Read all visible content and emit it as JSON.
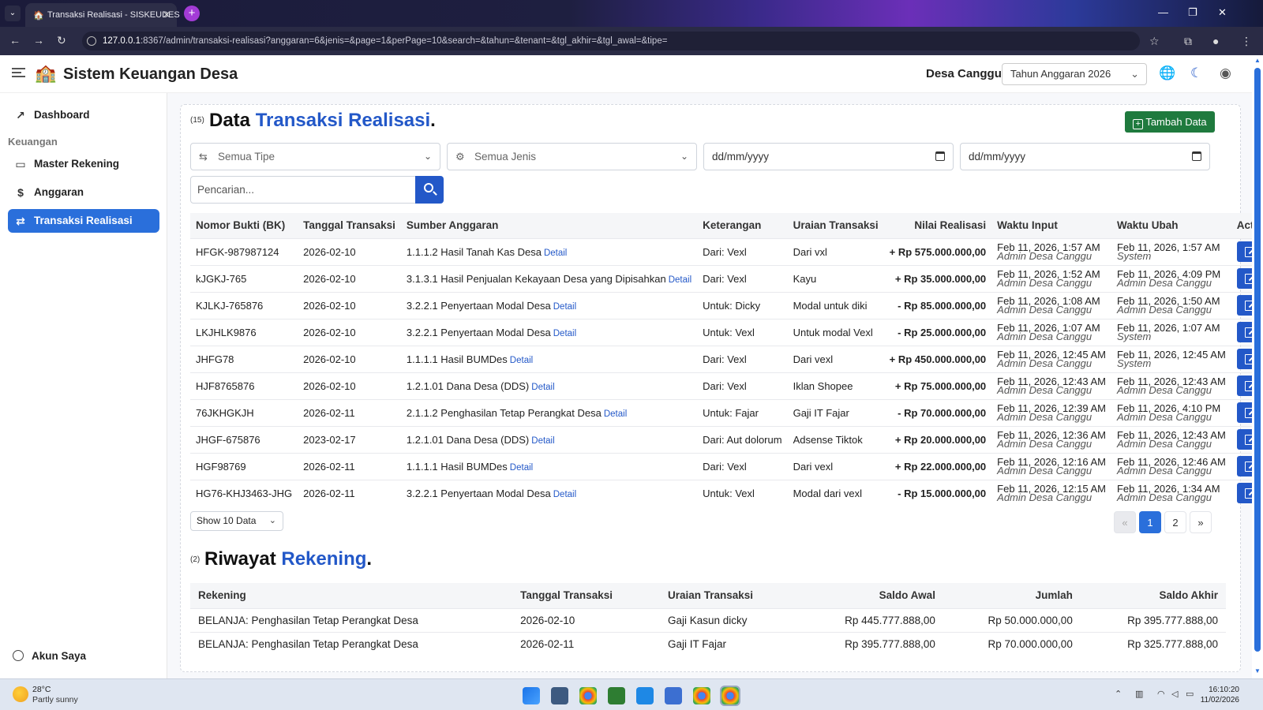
{
  "browser": {
    "tab_title": "Transaksi Realisasi - SISKEUDES",
    "url_host": "127.0.0.1",
    "url_rest": ":8367/admin/transaksi-realisasi?anggaran=6&jenis=&page=1&perPage=10&search=&tahun=&tenant=&tgl_akhir=&tgl_awal=&tipe="
  },
  "header": {
    "app_title": "Sistem Keuangan Desa",
    "desa": "Desa Canggu",
    "year_select": "Tahun Anggaran 2026"
  },
  "sidebar": {
    "dashboard": "Dashboard",
    "section": "Keuangan",
    "items": [
      {
        "label": "Master Rekening",
        "icon": "folder-icon"
      },
      {
        "label": "Anggaran",
        "icon": "dollar-icon"
      },
      {
        "label": "Transaksi Realisasi",
        "icon": "exchange-icon"
      }
    ],
    "account": "Akun Saya"
  },
  "transactions": {
    "count": "(15)",
    "title_plain": "Data ",
    "title_accent": "Transaksi Realisasi",
    "title_dot": ".",
    "add_button": "Tambah Data",
    "filters": {
      "tipe": "Semua Tipe",
      "jenis": "Semua Jenis",
      "tgl_awal": "dd/mm/yyyy",
      "tgl_akhir": "dd/mm/yyyy"
    },
    "search_placeholder": "Pencarian...",
    "columns": [
      "Nomor Bukti (BK)",
      "Tanggal Transaksi",
      "Sumber Anggaran",
      "Keterangan",
      "Uraian Transaksi",
      "Nilai Realisasi",
      "Waktu Input",
      "Waktu Ubah",
      "Action"
    ],
    "detail_label": "Detail",
    "rows": [
      {
        "bk": "HFGK-987987124",
        "date": "2026-02-10",
        "source": "1.1.1.2 Hasil Tanah Kas Desa",
        "ket": "Dari: Vexl",
        "uraian": "Dari vxl",
        "flow": "in",
        "nilai": "+ Rp 575.000.000,00",
        "input_time": "Feb 11, 2026, 1:57 AM",
        "input_by": "Admin Desa Canggu",
        "update_time": "Feb 11, 2026, 1:57 AM",
        "update_by": "System"
      },
      {
        "bk": "kJGKJ-765",
        "date": "2026-02-10",
        "source": "3.1.3.1 Hasil Penjualan Kekayaan Desa yang Dipisahkan",
        "ket": "Dari: Vexl",
        "uraian": "Kayu",
        "flow": "in",
        "nilai": "+ Rp 35.000.000,00",
        "input_time": "Feb 11, 2026, 1:52 AM",
        "input_by": "Admin Desa Canggu",
        "update_time": "Feb 11, 2026, 4:09 PM",
        "update_by": "Admin Desa Canggu"
      },
      {
        "bk": "KJLKJ-765876",
        "date": "2026-02-10",
        "source": "3.2.2.1 Penyertaan Modal Desa",
        "ket": "Untuk: Dicky",
        "uraian": "Modal untuk diki",
        "flow": "out",
        "nilai": "- Rp 85.000.000,00",
        "input_time": "Feb 11, 2026, 1:08 AM",
        "input_by": "Admin Desa Canggu",
        "update_time": "Feb 11, 2026, 1:50 AM",
        "update_by": "Admin Desa Canggu"
      },
      {
        "bk": "LKJHLK9876",
        "date": "2026-02-10",
        "source": "3.2.2.1 Penyertaan Modal Desa",
        "ket": "Untuk: Vexl",
        "uraian": "Untuk modal Vexl",
        "flow": "out",
        "nilai": "- Rp 25.000.000,00",
        "input_time": "Feb 11, 2026, 1:07 AM",
        "input_by": "Admin Desa Canggu",
        "update_time": "Feb 11, 2026, 1:07 AM",
        "update_by": "System"
      },
      {
        "bk": "JHFG78",
        "date": "2026-02-10",
        "source": "1.1.1.1 Hasil BUMDes",
        "ket": "Dari: Vexl",
        "uraian": "Dari vexl",
        "flow": "in",
        "nilai": "+ Rp 450.000.000,00",
        "input_time": "Feb 11, 2026, 12:45 AM",
        "input_by": "Admin Desa Canggu",
        "update_time": "Feb 11, 2026, 12:45 AM",
        "update_by": "System"
      },
      {
        "bk": "HJF8765876",
        "date": "2026-02-10",
        "source": "1.2.1.01 Dana Desa (DDS)",
        "ket": "Dari: Vexl",
        "uraian": "Iklan Shopee",
        "flow": "in",
        "nilai": "+ Rp 75.000.000,00",
        "input_time": "Feb 11, 2026, 12:43 AM",
        "input_by": "Admin Desa Canggu",
        "update_time": "Feb 11, 2026, 12:43 AM",
        "update_by": "Admin Desa Canggu"
      },
      {
        "bk": "76JKHGKJH",
        "date": "2026-02-11",
        "source": "2.1.1.2 Penghasilan Tetap Perangkat Desa",
        "ket": "Untuk: Fajar",
        "uraian": "Gaji IT Fajar",
        "flow": "out",
        "nilai": "- Rp 70.000.000,00",
        "input_time": "Feb 11, 2026, 12:39 AM",
        "input_by": "Admin Desa Canggu",
        "update_time": "Feb 11, 2026, 4:10 PM",
        "update_by": "Admin Desa Canggu"
      },
      {
        "bk": "JHGF-675876",
        "date": "2023-02-17",
        "source": "1.2.1.01 Dana Desa (DDS)",
        "ket": "Dari: Aut dolorum",
        "uraian": "Adsense Tiktok",
        "flow": "in",
        "nilai": "+ Rp 20.000.000,00",
        "input_time": "Feb 11, 2026, 12:36 AM",
        "input_by": "Admin Desa Canggu",
        "update_time": "Feb 11, 2026, 12:43 AM",
        "update_by": "Admin Desa Canggu"
      },
      {
        "bk": "HGF98769",
        "date": "2026-02-11",
        "source": "1.1.1.1 Hasil BUMDes",
        "ket": "Dari: Vexl",
        "uraian": "Dari vexl",
        "flow": "in",
        "nilai": "+ Rp 22.000.000,00",
        "input_time": "Feb 11, 2026, 12:16 AM",
        "input_by": "Admin Desa Canggu",
        "update_time": "Feb 11, 2026, 12:46 AM",
        "update_by": "Admin Desa Canggu"
      },
      {
        "bk": "HG76-KHJ3463-JHG",
        "date": "2026-02-11",
        "source": "3.2.2.1 Penyertaan Modal Desa",
        "ket": "Untuk: Vexl",
        "uraian": "Modal dari vexl",
        "flow": "out",
        "nilai": "- Rp 15.000.000,00",
        "input_time": "Feb 11, 2026, 12:15 AM",
        "input_by": "Admin Desa Canggu",
        "update_time": "Feb 11, 2026, 1:34 AM",
        "update_by": "Admin Desa Canggu"
      }
    ],
    "per_page": "Show 10 Data",
    "pagination": {
      "prev": "«",
      "pages": [
        "1",
        "2"
      ],
      "current": "1",
      "next": "»"
    }
  },
  "riwayat": {
    "count": "(2)",
    "title_plain": "Riwayat ",
    "title_accent": "Rekening",
    "title_dot": ".",
    "columns": [
      "Rekening",
      "Tanggal Transaksi",
      "Uraian Transaksi",
      "Saldo Awal",
      "Jumlah",
      "Saldo Akhir"
    ],
    "rows": [
      {
        "rekening": "BELANJA: Penghasilan Tetap Perangkat Desa",
        "date": "2026-02-10",
        "uraian": "Gaji Kasun dicky",
        "saldo_awal": "Rp 445.777.888,00",
        "jumlah": "Rp 50.000.000,00",
        "saldo_akhir": "Rp 395.777.888,00"
      },
      {
        "rekening": "BELANJA: Penghasilan Tetap Perangkat Desa",
        "date": "2026-02-11",
        "uraian": "Gaji IT Fajar",
        "saldo_awal": "Rp 395.777.888,00",
        "jumlah": "Rp 70.000.000,00",
        "saldo_akhir": "Rp 325.777.888,00"
      }
    ]
  },
  "taskbar": {
    "temp": "28°C",
    "weather": "Partly sunny",
    "time": "16:10:20",
    "date": "11/02/2026"
  },
  "colors": {
    "accent": "#2358c8",
    "active_nav": "#2a6fdb",
    "add_button": "#1f7a3e",
    "income": "#2a9d4a",
    "expense": "#d63a3a"
  }
}
